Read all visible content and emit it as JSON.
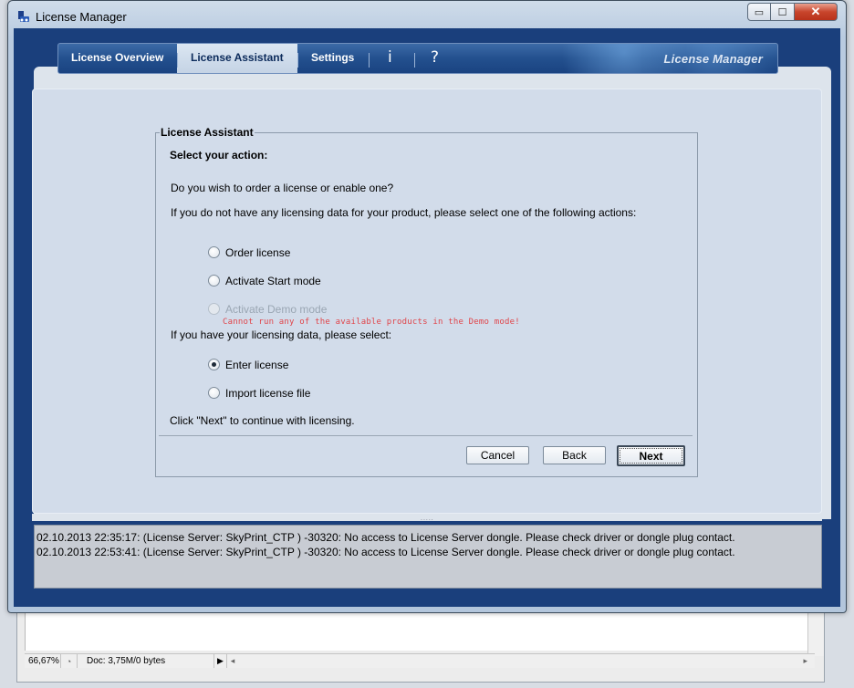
{
  "window": {
    "title": "License Manager",
    "controls": {
      "minimize": "▭",
      "maximize": "☐",
      "close": "✕"
    }
  },
  "tabs": [
    {
      "label": "License Overview",
      "active": false
    },
    {
      "label": "License Assistant",
      "active": true
    },
    {
      "label": "Settings",
      "active": false
    }
  ],
  "tab_icons": {
    "info": "i",
    "help": "?"
  },
  "brand": "License Manager",
  "assistant": {
    "legend": "License Assistant",
    "heading": "Select your action:",
    "question": "Do you wish to order a license or enable one?",
    "no_data_prompt": "If you do not have any licensing data for your product, please select one of the following actions:",
    "options_no_data": [
      {
        "label": "Order license",
        "checked": false,
        "disabled": false
      },
      {
        "label": "Activate Start mode",
        "checked": false,
        "disabled": false
      },
      {
        "label": "Activate Demo mode",
        "checked": false,
        "disabled": true
      }
    ],
    "demo_warning": "Cannot run any of the available products in the Demo mode!",
    "have_data_prompt": "If you have your licensing data, please select:",
    "options_have_data": [
      {
        "label": "Enter license",
        "checked": true,
        "disabled": false
      },
      {
        "label": "Import license file",
        "checked": false,
        "disabled": false
      }
    ],
    "continue_hint": "Click \"Next\" to continue with licensing.",
    "buttons": {
      "cancel": "Cancel",
      "back": "Back",
      "next": "Next"
    }
  },
  "splitter_grip": ".....",
  "log": [
    "02.10.2013 22:35:17: (License Server: SkyPrint_CTP )  -30320: No access to License Server dongle. Please check driver or dongle plug contact.",
    "02.10.2013 22:53:41: (License Server: SkyPrint_CTP )  -30320: No access to License Server dongle. Please check driver or dongle plug contact."
  ],
  "background_app": {
    "zoom": "66,67%",
    "doc_info": "Doc: 3,75M/0 bytes",
    "play_arrow": "▶",
    "scroll_left": "◂",
    "scroll_right": "▸"
  }
}
